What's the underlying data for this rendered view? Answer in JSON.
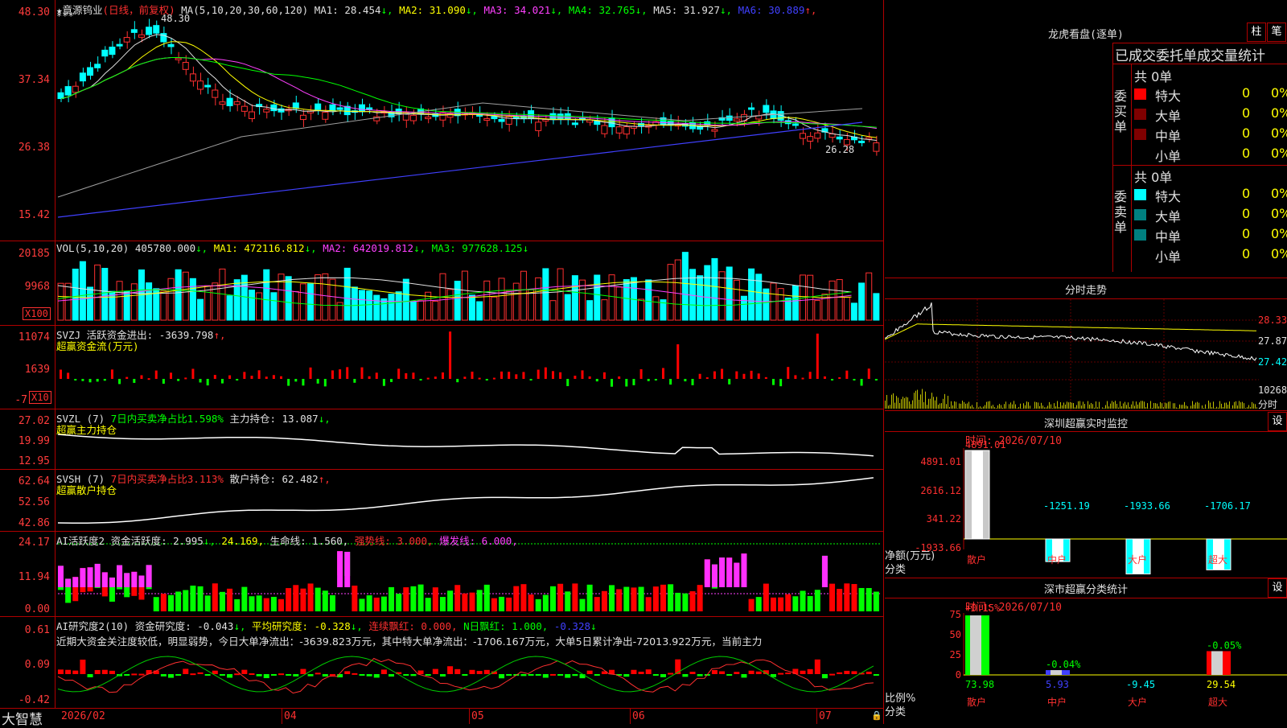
{
  "main": {
    "title_star": "★",
    "stock_name": "章源钨业",
    "period_mode": "(日线，前复权)",
    "ma_label": "MA(5,10,20,30,60,120)",
    "ma_values": [
      {
        "label": "MA1:",
        "value": "28.454",
        "arrow": "↓",
        "color": "#e0e0e0"
      },
      {
        "label": "MA2:",
        "value": "31.090",
        "arrow": "↓",
        "color": "#ffff00"
      },
      {
        "label": "MA3:",
        "value": "34.021",
        "arrow": "↓",
        "color": "#ff40ff"
      },
      {
        "label": "MA4:",
        "value": "32.765",
        "arrow": "↓",
        "color": "#00ff00"
      },
      {
        "label": "MA5:",
        "value": "31.927",
        "arrow": "↓",
        "color": "#e0e0e0"
      },
      {
        "label": "MA6:",
        "value": "30.889",
        "arrow": "↑",
        "color": "#4040ff"
      }
    ],
    "price_axis": [
      "48.30",
      "37.34",
      "26.38",
      "15.42"
    ],
    "peak_label": "48.30",
    "low_label": "26.28",
    "star_markers": "***"
  },
  "vol": {
    "label": "VOL(5,10,20)",
    "value": "405780.000",
    "ma1": "MA1: 472116.812",
    "ma2": "MA2: 642019.812",
    "ma3": "MA3: 977628.125",
    "axis": [
      "20185",
      "9968"
    ],
    "unit": "X100"
  },
  "svzj": {
    "label": "SVZJ",
    "line1": "活跃资金进出: -3639.798",
    "line2": "超赢资金流(万元)",
    "axis": [
      "11074",
      "1639",
      "-7"
    ],
    "unit": "X10"
  },
  "svzl": {
    "label": "SVZL (7)",
    "ratio": "7日内买卖净占比1.598%",
    "pos": "主力持仓: 13.087",
    "line2": "超赢主力持仓",
    "axis": [
      "27.02",
      "19.99",
      "12.95"
    ]
  },
  "svsh": {
    "label": "SVSH (7)",
    "ratio": "7日内买卖净占比3.113%",
    "pos": "散户持仓: 62.482",
    "line2": "超赢散户持仓",
    "axis": [
      "62.64",
      "52.56",
      "42.86"
    ]
  },
  "ai1": {
    "label": "AI活跃度2",
    "a": "资金活跃度: 2.995",
    "b": "24.169,",
    "c": "生命线: 1.560,",
    "d": "强势线: 3.000,",
    "e": "爆发线: 6.000,",
    "axis": [
      "24.17",
      "11.94",
      "0.00"
    ]
  },
  "ai2": {
    "label": "AI研究度2(10)",
    "a": "资金研究度: -0.043",
    "b": "平均研究度: -0.328",
    "c": "连续飘红: 0.000,",
    "d": "N日飘红: 1.000,",
    "e": "-0.328",
    "comment": "近期大资金关注度较低，明显弱势，今日大单净流出：-3639.823万元，其中特大单净流出：-1706.167万元，大单5日累计净出-72013.922万元，当前主力",
    "axis": [
      "0.61",
      "0.09",
      "-0.42"
    ]
  },
  "bottom": {
    "brand": "大智慧",
    "dates": [
      "2026/02",
      "04",
      "05",
      "06",
      "07"
    ]
  },
  "dragon": {
    "title": "龙虎看盘(逐单)",
    "btn1": "柱",
    "btn2": "笔",
    "subtitle": "已成交委托单成交量统计",
    "buy_label": "委买单",
    "sell_label": "委卖单",
    "buy_total": "共 0单",
    "sell_total": "共 0单",
    "buy_rows": [
      {
        "name": "特大",
        "count": "0",
        "pct": "0%",
        "color": "#ff0000"
      },
      {
        "name": "大单",
        "count": "0",
        "pct": "0%",
        "color": "#800000"
      },
      {
        "name": "中单",
        "count": "0",
        "pct": "0%",
        "color": "#800000"
      },
      {
        "name": "小单",
        "count": "0",
        "pct": "0%",
        "color": ""
      }
    ],
    "sell_rows": [
      {
        "name": "特大",
        "count": "0",
        "pct": "0%",
        "color": "#00ffff"
      },
      {
        "name": "大单",
        "count": "0",
        "pct": "0%",
        "color": "#008080"
      },
      {
        "name": "中单",
        "count": "0",
        "pct": "0%",
        "color": "#008080"
      },
      {
        "name": "小单",
        "count": "0",
        "pct": "0%",
        "color": ""
      }
    ]
  },
  "intraday": {
    "title": "分时走势",
    "axis": [
      "28.33",
      "27.87",
      "27.42",
      "10268"
    ],
    "unit": "分时"
  },
  "monitor": {
    "title": "深圳超赢实时监控",
    "btn": "设",
    "time": "时间: 2026/07/10",
    "axis": [
      "4891.01",
      "2616.12",
      "341.22",
      "-1933.66"
    ],
    "ylabel": "净额(万元)",
    "xlabel": "分类",
    "cats": [
      "散户",
      "中户",
      "大户",
      "超大"
    ],
    "values": [
      "4891.01",
      "-1251.19",
      "-1933.66",
      "-1706.17"
    ]
  },
  "classify": {
    "title": "深市超赢分类统计",
    "btn": "设",
    "time": "时间: 2026/07/10",
    "axis": [
      "75",
      "50",
      "25",
      "0"
    ],
    "ylabel": "比例%",
    "xlabel": "分类",
    "cats": [
      "散户",
      "中户",
      "大户",
      "超大"
    ],
    "top": [
      "+0.15%",
      "-0.04%",
      "",
      "-0.05%"
    ],
    "bottom": [
      "73.98",
      "5.93",
      "-9.45",
      "29.54"
    ]
  }
}
